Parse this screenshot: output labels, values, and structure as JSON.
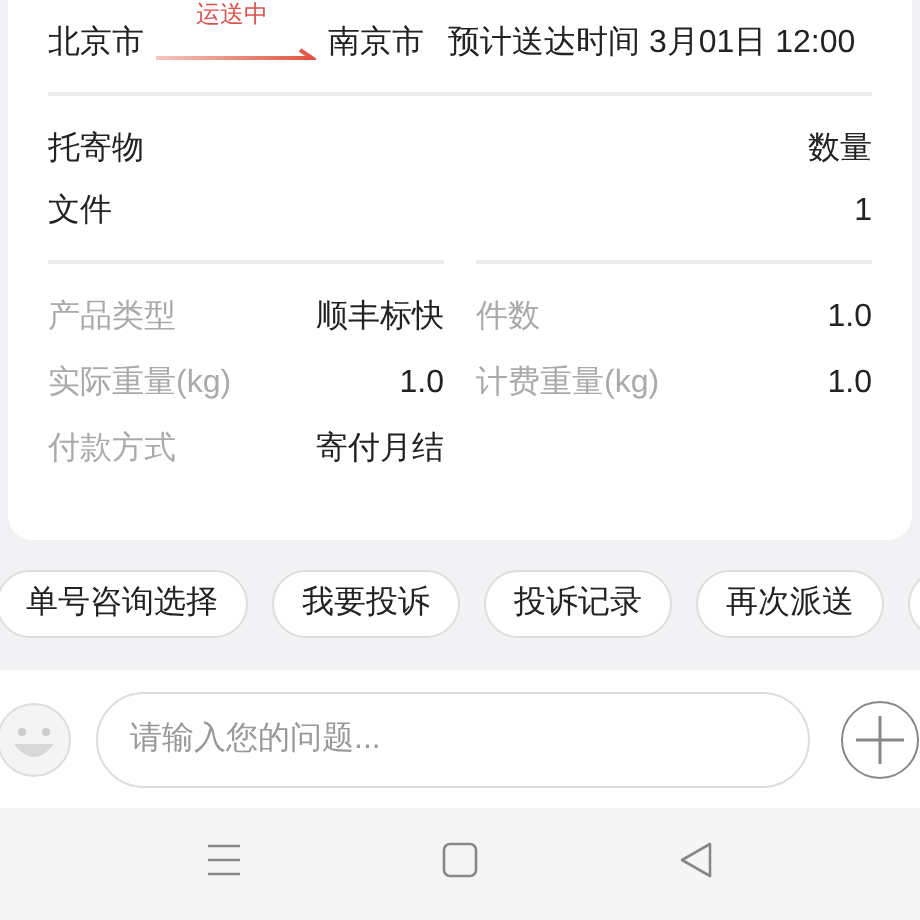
{
  "route": {
    "origin": "北京市",
    "status": "运送中",
    "destination": "南京市",
    "eta": "预计送达时间 3月01日 12:00"
  },
  "goods": {
    "header": [
      "托寄物",
      "数量"
    ],
    "rows": [
      {
        "name": "文件",
        "quantity": "1"
      }
    ]
  },
  "details": [
    {
      "label": "产品类型",
      "value": "顺丰标快"
    },
    {
      "label": "件数",
      "value": "1.0"
    },
    {
      "label": "实际重量(kg)",
      "value": "1.0"
    },
    {
      "label": "计费重量(kg)",
      "value": "1.0"
    },
    {
      "label": "付款方式",
      "value": "寄付月结"
    }
  ],
  "quick_replies": [
    "单号咨询选择",
    "我要投诉",
    "投诉记录",
    "再次派送"
  ],
  "input": {
    "placeholder": "请输入您的问题..."
  }
}
